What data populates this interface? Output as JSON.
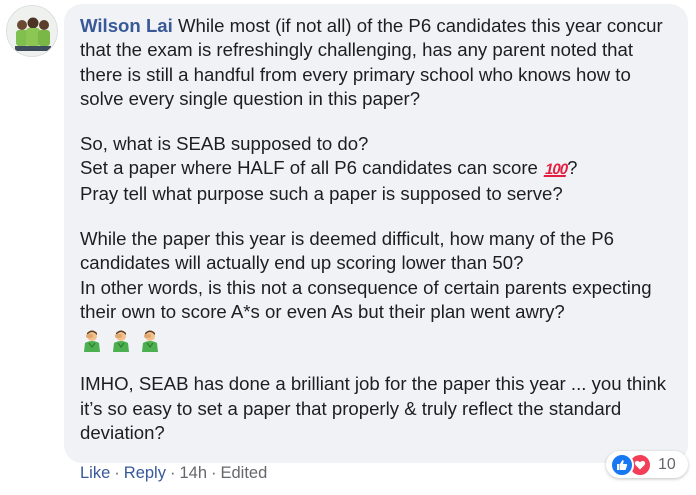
{
  "comment": {
    "author": "Wilson Lai",
    "paragraphs": [
      [
        "While most (if not all) of the P6 candidates this year concur that the exam is refreshingly challenging, has any parent noted that there is still a handful from every primary school who knows how to solve every single question in this paper?"
      ],
      [
        "So, what is SEAB supposed to do?",
        "Set a paper where HALF of all P6 candidates can score",
        "?",
        "Pray tell what purpose such a paper is supposed to serve?"
      ],
      [
        "While the paper this year is deemed difficult, how many of the P6 candidates will actually end up scoring lower than 50?",
        "In other words, is this not a consequence of certain parents expecting their own to score A*s or even As but their plan went awry?"
      ],
      [
        "IMHO, SEAB has done a brilliant job for the paper this year ... you think it’s so easy to set a paper that properly & truly reflect the standard deviation?"
      ]
    ],
    "emoji_100": "100",
    "emoji_row": [
      "facepalm-icon",
      "facepalm-icon",
      "facepalm-icon"
    ]
  },
  "actions": {
    "like": "Like",
    "reply": "Reply",
    "time": "14h",
    "edited": "Edited",
    "separator": "·"
  },
  "reactions": {
    "types": [
      "like-reaction-icon",
      "love-reaction-icon"
    ],
    "count": "10"
  },
  "colors": {
    "author": "#385898",
    "bubble": "#f0f2f5",
    "text": "#1c1e21",
    "meta": "#65676b",
    "like": "#1877f2",
    "love": "#f33e58"
  }
}
